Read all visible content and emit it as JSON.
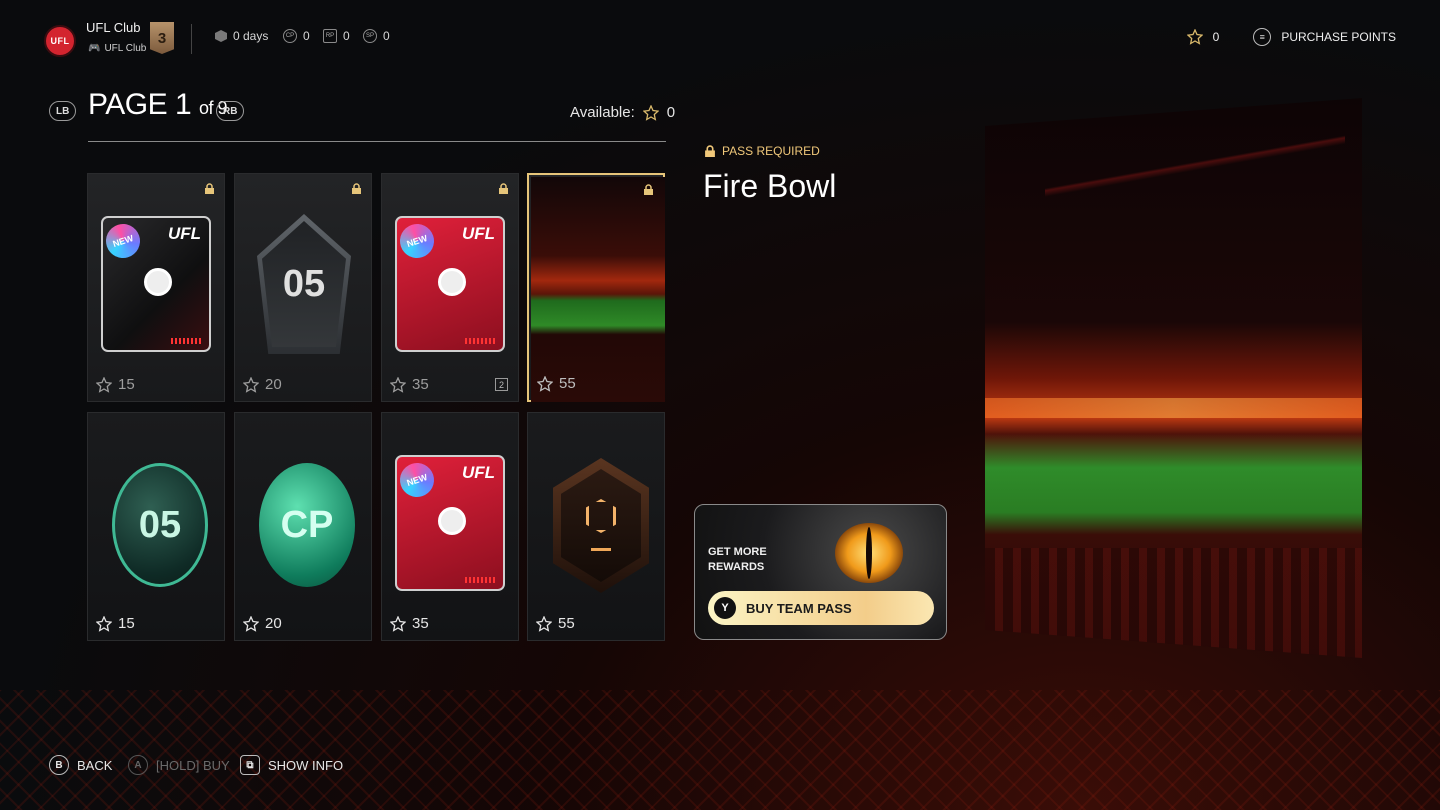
{
  "header": {
    "club_logo_text": "UFL",
    "club_name": "UFL Club",
    "club_sub": "UFL Club",
    "rank": "3",
    "stats": [
      {
        "icon": "hex-badge-icon",
        "value": "0 days"
      },
      {
        "icon": "cp-coin-icon",
        "value": "0"
      },
      {
        "icon": "rp-icon",
        "value": "0"
      },
      {
        "icon": "sp-icon",
        "value": "0"
      }
    ],
    "points": "0",
    "purchase_label": "PURCHASE POINTS"
  },
  "pager": {
    "lb": "LB",
    "rb": "RB",
    "page_label": "PAGE 1",
    "of_label": "of 9",
    "available_label": "Available:",
    "available_value": "0"
  },
  "items": [
    {
      "kind": "pack-dark",
      "price": "15",
      "locked": true
    },
    {
      "kind": "pentagon",
      "label": "05",
      "price": "20",
      "locked": true
    },
    {
      "kind": "pack-red",
      "price": "35",
      "locked": true,
      "qty": "2"
    },
    {
      "kind": "stadium",
      "price": "55",
      "locked": true,
      "selected": true
    },
    {
      "kind": "coin-glass",
      "label": "05",
      "price": "15"
    },
    {
      "kind": "coin-cp",
      "label": "CP",
      "price": "20"
    },
    {
      "kind": "pack-red",
      "price": "35"
    },
    {
      "kind": "hex-badge",
      "price": "55"
    }
  ],
  "detail": {
    "pass_required": "PASS REQUIRED",
    "title": "Fire Bowl"
  },
  "promo": {
    "line1": "GET MORE",
    "line2": "REWARDS",
    "button_key": "Y",
    "button_label": "BUY TEAM PASS"
  },
  "footer": [
    {
      "key": "B",
      "label": "BACK",
      "enabled": true
    },
    {
      "key": "A",
      "label": "[HOLD] BUY",
      "enabled": false
    },
    {
      "key": "⧉",
      "label": "SHOW INFO",
      "enabled": true
    }
  ],
  "colors": {
    "accent_gold": "#e6c57a",
    "pass_text": "#f0c87a",
    "club_red": "#d3242f"
  }
}
